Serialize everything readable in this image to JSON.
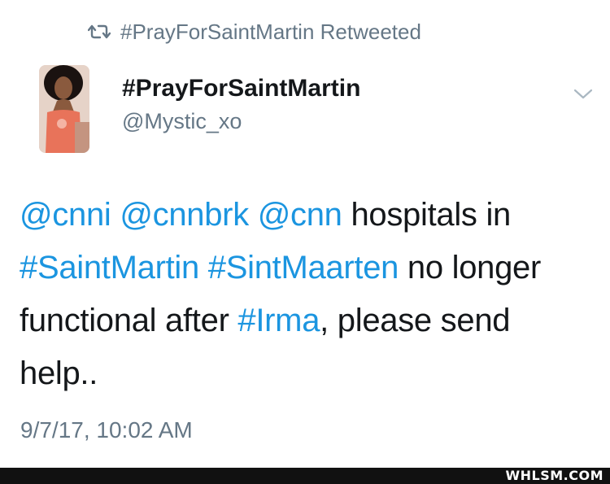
{
  "retweet_bar": {
    "icon": "retweet-icon",
    "text": "#PrayForSaintMartin Retweeted"
  },
  "author": {
    "display_name": "#PrayForSaintMartin",
    "handle": "@Mystic_xo",
    "avatar_icon": "profile-photo"
  },
  "menu": {
    "icon": "chevron-down-icon"
  },
  "tweet": {
    "segments": [
      {
        "text": "@cnni",
        "kind": "mention"
      },
      {
        "text": " ",
        "kind": "text"
      },
      {
        "text": "@cnnbrk",
        "kind": "mention"
      },
      {
        "text": " ",
        "kind": "text"
      },
      {
        "text": "@cnn",
        "kind": "mention"
      },
      {
        "text": " hospitals in ",
        "kind": "text"
      },
      {
        "text": "#SaintMartin",
        "kind": "hashtag"
      },
      {
        "text": " ",
        "kind": "text"
      },
      {
        "text": "#SintMaarten",
        "kind": "hashtag"
      },
      {
        "text": " no longer functional after ",
        "kind": "text"
      },
      {
        "text": "#Irma",
        "kind": "hashtag"
      },
      {
        "text": ", please send help..",
        "kind": "text"
      }
    ]
  },
  "timestamp": "9/7/17, 10:02 AM",
  "watermark": "WHLSM.COM",
  "colors": {
    "link": "#1b95e0",
    "muted": "#657786",
    "text": "#14171a"
  }
}
